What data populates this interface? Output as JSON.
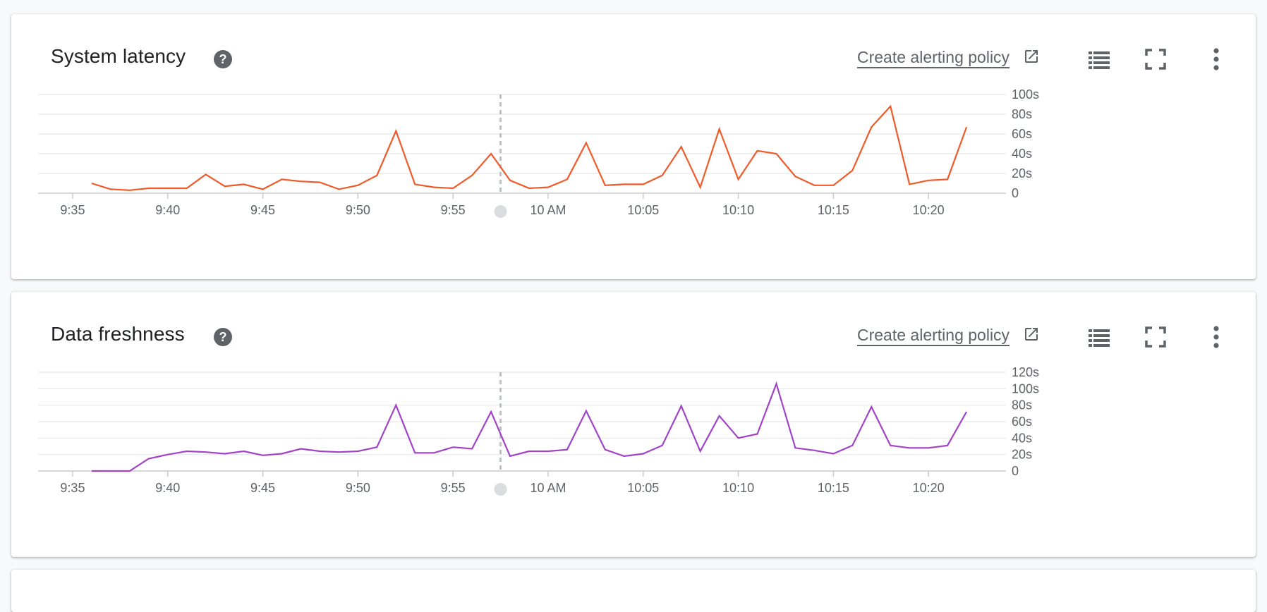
{
  "colors": {
    "latency": "#f05a28",
    "freshness": "#a142c8"
  },
  "icons": {
    "help": "help-circle-icon",
    "external": "open-in-new-icon",
    "legend": "legend-list-icon",
    "fullscreen": "fullscreen-icon",
    "more": "more-vert-icon"
  },
  "panels": [
    {
      "title": "System latency",
      "alert_label": "Create alerting policy"
    },
    {
      "title": "Data freshness",
      "alert_label": "Create alerting policy"
    }
  ],
  "chart_data": [
    {
      "type": "line",
      "title": "System latency",
      "grid": true,
      "x_unit": "minutes",
      "xlim": [
        "9:34",
        "10:24"
      ],
      "x_ticks": [
        "9:35",
        "9:40",
        "9:45",
        "9:50",
        "9:55",
        "10 AM",
        "10:05",
        "10:10",
        "10:15",
        "10:20"
      ],
      "ylim": [
        0,
        100
      ],
      "y_ticks": [
        "0",
        "20s",
        "40s",
        "60s",
        "80s",
        "100s"
      ],
      "marker_x": "9:57.5",
      "series": [
        {
          "color": "#f05a28",
          "x": [
            "9:36",
            "9:37",
            "9:38",
            "9:39",
            "9:40",
            "9:41",
            "9:42",
            "9:43",
            "9:44",
            "9:45",
            "9:46",
            "9:47",
            "9:48",
            "9:49",
            "9:50",
            "9:51",
            "9:52",
            "9:53",
            "9:54",
            "9:55",
            "9:56",
            "9:57",
            "9:58",
            "9:59",
            "10:00",
            "10:01",
            "10:02",
            "10:03",
            "10:04",
            "10:05",
            "10:06",
            "10:07",
            "10:08",
            "10:09",
            "10:10",
            "10:11",
            "10:12",
            "10:13",
            "10:14",
            "10:15",
            "10:16",
            "10:17",
            "10:18",
            "10:19",
            "10:20",
            "10:21",
            "10:22"
          ],
          "values": [
            10,
            4,
            3,
            5,
            5,
            5,
            19,
            7,
            9,
            4,
            14,
            12,
            11,
            4,
            8,
            18,
            63,
            9,
            6,
            5,
            18,
            40,
            13,
            5,
            6,
            14,
            51,
            8,
            9,
            9,
            18,
            47,
            6,
            65,
            14,
            43,
            40,
            17,
            8,
            8,
            23,
            67,
            88,
            9,
            13,
            14,
            67
          ]
        }
      ]
    },
    {
      "type": "line",
      "title": "Data freshness",
      "grid": true,
      "x_unit": "minutes",
      "xlim": [
        "9:34",
        "10:24"
      ],
      "x_ticks": [
        "9:35",
        "9:40",
        "9:45",
        "9:50",
        "9:55",
        "10 AM",
        "10:05",
        "10:10",
        "10:15",
        "10:20"
      ],
      "ylim": [
        0,
        120
      ],
      "y_ticks": [
        "0",
        "20s",
        "40s",
        "60s",
        "80s",
        "100s",
        "120s"
      ],
      "marker_x": "9:57.5",
      "series": [
        {
          "color": "#a142c8",
          "x": [
            "9:36",
            "9:37",
            "9:38",
            "9:39",
            "9:40",
            "9:41",
            "9:42",
            "9:43",
            "9:44",
            "9:45",
            "9:46",
            "9:47",
            "9:48",
            "9:49",
            "9:50",
            "9:51",
            "9:52",
            "9:53",
            "9:54",
            "9:55",
            "9:56",
            "9:57",
            "9:58",
            "9:59",
            "10:00",
            "10:01",
            "10:02",
            "10:03",
            "10:04",
            "10:05",
            "10:06",
            "10:07",
            "10:08",
            "10:09",
            "10:10",
            "10:11",
            "10:12",
            "10:13",
            "10:14",
            "10:15",
            "10:16",
            "10:17",
            "10:18",
            "10:19",
            "10:20",
            "10:21",
            "10:22"
          ],
          "values": [
            0,
            0,
            0,
            15,
            20,
            24,
            23,
            21,
            24,
            19,
            21,
            27,
            24,
            23,
            24,
            29,
            80,
            22,
            22,
            29,
            27,
            72,
            18,
            24,
            24,
            26,
            73,
            26,
            18,
            21,
            31,
            79,
            24,
            67,
            40,
            45,
            106,
            28,
            25,
            21,
            31,
            78,
            31,
            28,
            28,
            31,
            72
          ]
        }
      ]
    }
  ]
}
